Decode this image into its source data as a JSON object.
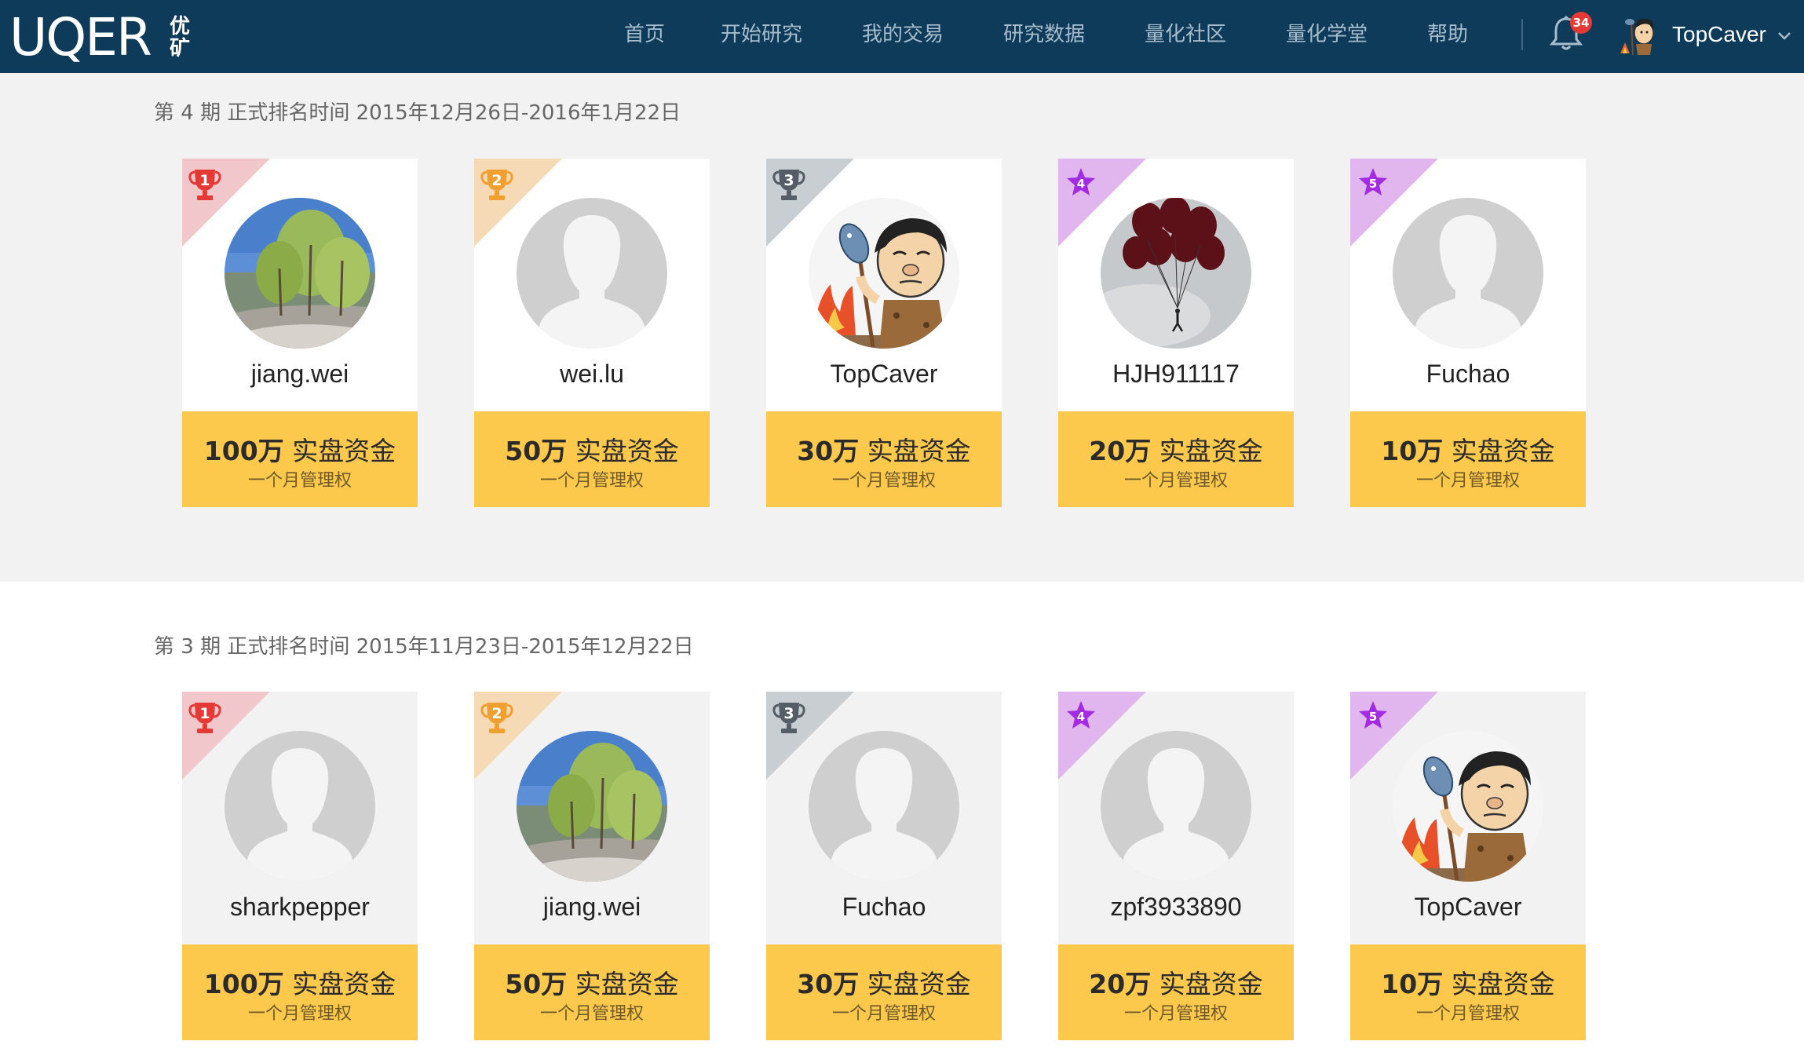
{
  "header": {
    "logo_text": "UQER",
    "logo_cn": "优矿",
    "nav": [
      "首页",
      "开始研究",
      "我的交易",
      "研究数据",
      "量化社区",
      "量化学堂",
      "帮助"
    ],
    "notification_count": "34",
    "username": "TopCaver"
  },
  "sections": [
    {
      "title": "第 4 期  正式排名时间 2015年12月26日-2016年1月22日",
      "cards": [
        {
          "rank": "1",
          "name": "jiang.wei",
          "avatar": "landscape-photo",
          "amount": "100万",
          "prize": "实盘资金",
          "sub": "一个月管理权"
        },
        {
          "rank": "2",
          "name": "wei.lu",
          "avatar": "default-silhouette",
          "amount": "50万",
          "prize": "实盘资金",
          "sub": "一个月管理权"
        },
        {
          "rank": "3",
          "name": "TopCaver",
          "avatar": "caveman-cartoon",
          "amount": "30万",
          "prize": "实盘资金",
          "sub": "一个月管理权"
        },
        {
          "rank": "4",
          "name": "HJH911117",
          "avatar": "balloons-photo",
          "amount": "20万",
          "prize": "实盘资金",
          "sub": "一个月管理权"
        },
        {
          "rank": "5",
          "name": "Fuchao",
          "avatar": "default-silhouette",
          "amount": "10万",
          "prize": "实盘资金",
          "sub": "一个月管理权"
        }
      ]
    },
    {
      "title": "第 3 期  正式排名时间 2015年11月23日-2015年12月22日",
      "cards": [
        {
          "rank": "1",
          "name": "sharkpepper",
          "avatar": "default-silhouette",
          "amount": "100万",
          "prize": "实盘资金",
          "sub": "一个月管理权"
        },
        {
          "rank": "2",
          "name": "jiang.wei",
          "avatar": "landscape-photo",
          "amount": "50万",
          "prize": "实盘资金",
          "sub": "一个月管理权"
        },
        {
          "rank": "3",
          "name": "Fuchao",
          "avatar": "default-silhouette",
          "amount": "30万",
          "prize": "实盘资金",
          "sub": "一个月管理权"
        },
        {
          "rank": "4",
          "name": "zpf3933890",
          "avatar": "default-silhouette",
          "amount": "20万",
          "prize": "实盘资金",
          "sub": "一个月管理权"
        },
        {
          "rank": "5",
          "name": "TopCaver",
          "avatar": "caveman-cartoon",
          "amount": "10万",
          "prize": "实盘资金",
          "sub": "一个月管理权"
        }
      ]
    }
  ],
  "colors": {
    "header_bg": "#0e3b5a",
    "prize_bg": "#fdc94d",
    "rank1": "#f2c7cc",
    "rank2": "#f6dab5",
    "rank3": "#c9ced3",
    "rank45": "#e1b5ee",
    "badge": "#e53935"
  },
  "icons": {
    "rank1": "red-trophy-icon",
    "rank2": "orange-trophy-icon",
    "rank3": "gray-trophy-icon",
    "rank4": "purple-star-icon",
    "rank5": "purple-star-icon",
    "notification": "bell-icon",
    "user_menu": "chevron-down-icon"
  }
}
